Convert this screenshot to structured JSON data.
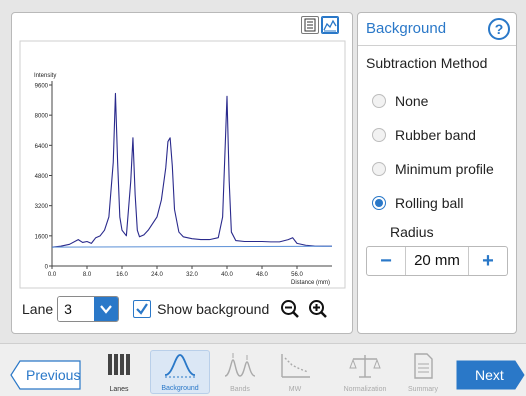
{
  "toolbar": {
    "table_view_icon": "table-view-icon",
    "chart_view_icon": "chart-view-icon"
  },
  "chart_data": {
    "type": "line",
    "title": "",
    "ylabel": "Intensity",
    "xlabel": "Distance (mm)",
    "ylim": [
      0,
      9600
    ],
    "xlim": [
      0,
      64
    ],
    "yticks": [
      0,
      1600,
      3200,
      4800,
      6400,
      8000,
      9600
    ],
    "ytick_labels": [
      "0",
      "1600",
      "3200",
      "4800",
      "6400",
      "8000",
      "9600"
    ],
    "xticks": [
      0,
      8,
      16,
      24,
      32,
      40,
      48,
      56
    ],
    "xtick_labels": [
      "0.0",
      "8.0",
      "16.0",
      "24.0",
      "32.0",
      "40.0",
      "48.0",
      "56.0"
    ],
    "grid": false,
    "series": [
      {
        "color": "#2a2a8c",
        "x": [
          0,
          2,
          4,
          6,
          7,
          8,
          9,
          10,
          11,
          12,
          13,
          14,
          14.5,
          15,
          15.5,
          16,
          17,
          18,
          18.5,
          19,
          19.5,
          20,
          21,
          22,
          24,
          25,
          26,
          26.5,
          27,
          27.5,
          28,
          29,
          30,
          32,
          34,
          36,
          38,
          39,
          40,
          40.5,
          41,
          42,
          44,
          46,
          48,
          50,
          52,
          54,
          55,
          56,
          58,
          60,
          62,
          64
        ],
        "y": [
          1000,
          1050,
          1150,
          1400,
          1250,
          1300,
          1200,
          1500,
          1600,
          1900,
          2600,
          5500,
          9150,
          5500,
          2600,
          1900,
          1600,
          4500,
          6800,
          3800,
          1900,
          1550,
          1650,
          1900,
          2600,
          3500,
          5200,
          6600,
          6800,
          5300,
          3000,
          1800,
          1550,
          1450,
          1400,
          1400,
          1500,
          2600,
          9000,
          4500,
          1800,
          1350,
          1300,
          1300,
          1300,
          1280,
          1280,
          1400,
          1500,
          1200,
          1100,
          1060,
          1050,
          1050
        ]
      },
      {
        "color": "#5a8fd6",
        "x": [
          0,
          64
        ],
        "y": [
          1000,
          1050
        ]
      }
    ]
  },
  "controls": {
    "lane_label": "Lane",
    "lane_value": "3",
    "show_background_label": "Show background",
    "show_background_checked": true
  },
  "panel": {
    "title": "Background",
    "help": "?",
    "method_title": "Subtraction Method",
    "methods": [
      {
        "label": "None",
        "selected": false
      },
      {
        "label": "Rubber band",
        "selected": false
      },
      {
        "label": "Minimum profile",
        "selected": false
      },
      {
        "label": "Rolling ball",
        "selected": true
      }
    ],
    "radius_title": "Radius",
    "radius_value": "20 mm",
    "minus": "−",
    "plus": "+"
  },
  "nav": {
    "previous": "Previous",
    "next": "Next",
    "steps": [
      {
        "label": "Lanes",
        "icon": "lanes-icon",
        "state": "enabled"
      },
      {
        "label": "Background",
        "icon": "background-icon",
        "state": "active"
      },
      {
        "label": "Bands",
        "icon": "bands-icon",
        "state": "disabled"
      },
      {
        "label": "MW",
        "icon": "mw-icon",
        "state": "disabled"
      },
      {
        "label": "Normalization",
        "icon": "normalization-icon",
        "state": "disabled"
      },
      {
        "label": "Summary",
        "icon": "summary-icon",
        "state": "disabled"
      }
    ]
  },
  "colors": {
    "accent": "#2a78c8",
    "plot_line": "#2a2a8c",
    "baseline": "#5a8fd6"
  }
}
